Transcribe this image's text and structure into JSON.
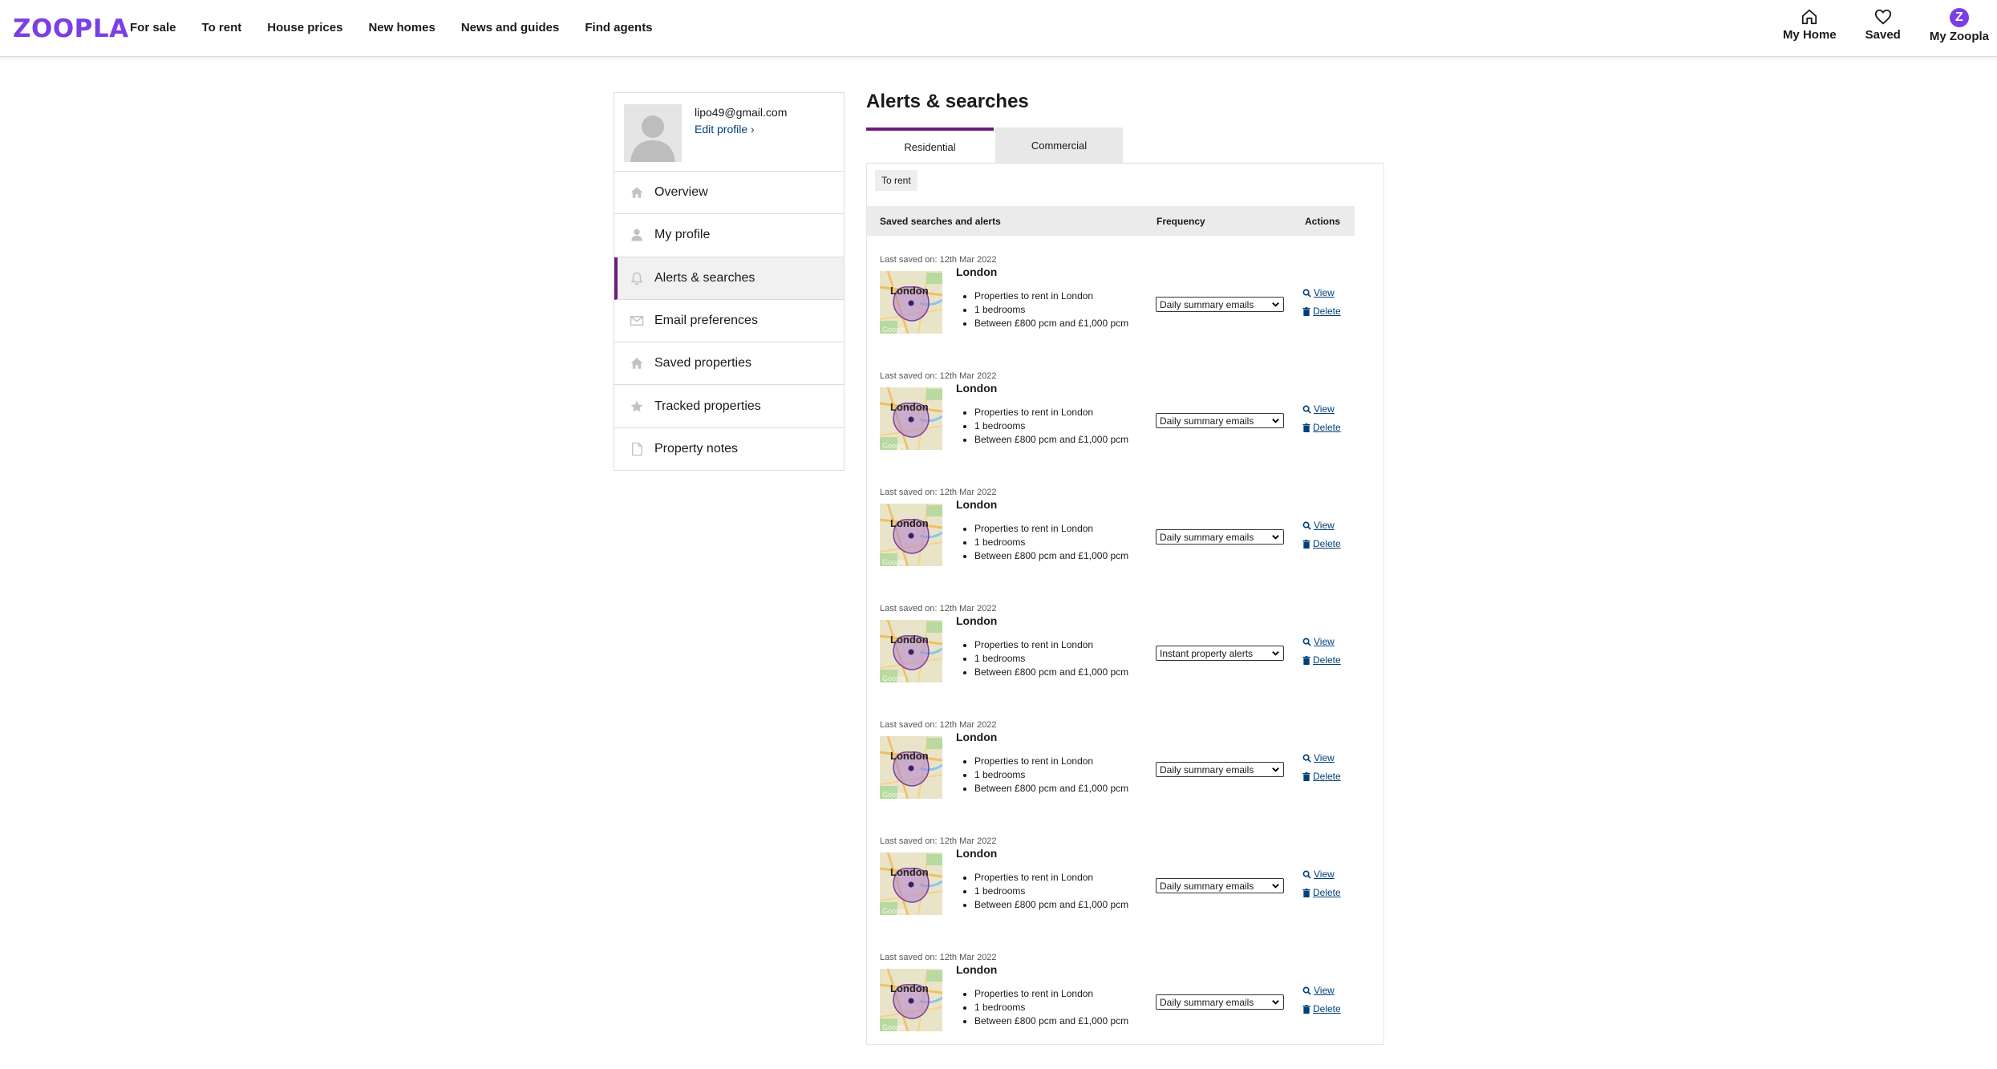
{
  "header": {
    "logo": "ZOOPLA",
    "nav": [
      "For sale",
      "To rent",
      "House prices",
      "New homes",
      "News and guides",
      "Find agents"
    ],
    "user_nav": {
      "my_home": "My Home",
      "saved": "Saved",
      "my_zoopla": "My Zoopla",
      "badge_letter": "Z"
    }
  },
  "sidebar": {
    "email": "lipo49@gmail.com",
    "edit_profile": "Edit profile ›",
    "items": [
      {
        "label": "Overview",
        "icon": "home-icon"
      },
      {
        "label": "My profile",
        "icon": "person-icon"
      },
      {
        "label": "Alerts & searches",
        "icon": "bell-icon",
        "active": true
      },
      {
        "label": "Email preferences",
        "icon": "envelope-icon"
      },
      {
        "label": "Saved properties",
        "icon": "home-icon"
      },
      {
        "label": "Tracked properties",
        "icon": "star-icon"
      },
      {
        "label": "Property notes",
        "icon": "document-icon"
      }
    ]
  },
  "main": {
    "title": "Alerts & searches",
    "tabs": [
      "Residential",
      "Commercial"
    ],
    "active_tab": "Residential",
    "subtab": "To rent",
    "table": {
      "headers": [
        "Saved searches and alerts",
        "Frequency",
        "Actions"
      ],
      "view_label": "View",
      "delete_label": "Delete",
      "map_label": "London",
      "rows": [
        {
          "saved": "Last saved on: 12th Mar 2022",
          "title": "London",
          "details": [
            "Properties to rent in London",
            "1 bedrooms",
            "Between £800 pcm and £1,000 pcm"
          ],
          "frequency": "Daily summary emails"
        },
        {
          "saved": "Last saved on: 12th Mar 2022",
          "title": "London",
          "details": [
            "Properties to rent in London",
            "1 bedrooms",
            "Between £800 pcm and £1,000 pcm"
          ],
          "frequency": "Daily summary emails"
        },
        {
          "saved": "Last saved on: 12th Mar 2022",
          "title": "London",
          "details": [
            "Properties to rent in London",
            "1 bedrooms",
            "Between £800 pcm and £1,000 pcm"
          ],
          "frequency": "Daily summary emails"
        },
        {
          "saved": "Last saved on: 12th Mar 2022",
          "title": "London",
          "details": [
            "Properties to rent in London",
            "1 bedrooms",
            "Between £800 pcm and £1,000 pcm"
          ],
          "frequency": "Instant property alerts"
        },
        {
          "saved": "Last saved on: 12th Mar 2022",
          "title": "London",
          "details": [
            "Properties to rent in London",
            "1 bedrooms",
            "Between £800 pcm and £1,000 pcm"
          ],
          "frequency": "Daily summary emails"
        },
        {
          "saved": "Last saved on: 12th Mar 2022",
          "title": "London",
          "details": [
            "Properties to rent in London",
            "1 bedrooms",
            "Between £800 pcm and £1,000 pcm"
          ],
          "frequency": "Daily summary emails"
        },
        {
          "saved": "Last saved on: 12th Mar 2022",
          "title": "London",
          "details": [
            "Properties to rent in London",
            "1 bedrooms",
            "Between £800 pcm and £1,000 pcm"
          ],
          "frequency": "Daily summary emails"
        }
      ]
    }
  },
  "colors": {
    "brand": "#7b3fe4",
    "active_accent": "#6c1d7a",
    "link": "#00407a"
  }
}
